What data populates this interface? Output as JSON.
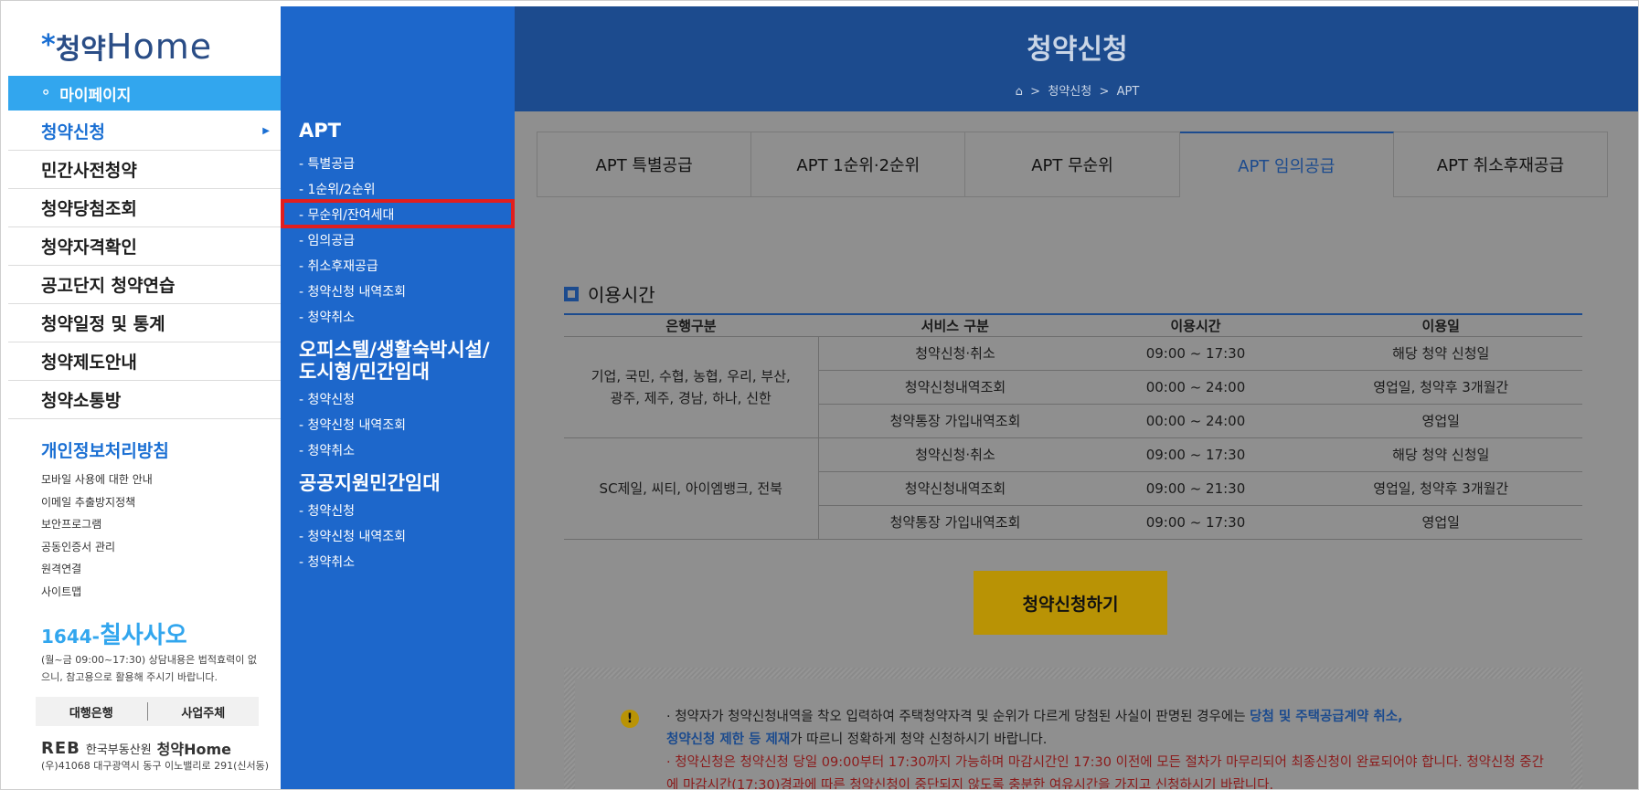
{
  "logo": {
    "star": "*",
    "kr": "청약",
    "en": "Home"
  },
  "mypage": {
    "icon": "person-icon",
    "label": "마이페이지"
  },
  "menu": [
    {
      "label": "청약신청",
      "active": true
    },
    {
      "label": "민간사전청약"
    },
    {
      "label": "청약당첨조회"
    },
    {
      "label": "청약자격확인"
    },
    {
      "label": "공고단지 청약연습"
    },
    {
      "label": "청약일정 및 통계"
    },
    {
      "label": "청약제도안내"
    },
    {
      "label": "청약소통방"
    }
  ],
  "privacy": "개인정보처리방침",
  "links": [
    "모바일 사용에 대한 안내",
    "이메일 추출방지정책",
    "보안프로그램",
    "공동인증서 관리",
    "원격연결",
    "사이트맵"
  ],
  "phone": {
    "prefix": "1644-",
    "name": "칠사사오"
  },
  "hours_notice": "(월~금 09:00~17:30) 상담내용은 법적효력이 없으니, 참고용으로 활용해 주시기 바랍니다.",
  "footer_tabs": [
    "대행은행",
    "사업주체"
  ],
  "reb": {
    "logo": "REB",
    "org": "한국부동산원",
    "home": "청약Home"
  },
  "address": "(우)41068 대구광역시 동구 이노밸리로 291(신서동)",
  "submenu": {
    "apt": {
      "title": "APT",
      "items": [
        "- 특별공급",
        "- 1순위/2순위",
        "- 무순위/잔여세대",
        "- 임의공급",
        "- 취소후재공급",
        "- 청약신청 내역조회",
        "- 청약취소"
      ]
    },
    "officetel": {
      "title_line1": "오피스텔/생활숙박시설/",
      "title_line2": "도시형/민간임대",
      "items": [
        "- 청약신청",
        "- 청약신청 내역조회",
        "- 청약취소"
      ]
    },
    "public": {
      "title": "공공지원민간임대",
      "items": [
        "- 청약신청",
        "- 청약신청 내역조회",
        "- 청약취소"
      ]
    }
  },
  "banner": {
    "title": "청약신청",
    "home_icon": "home-icon",
    "crumb1": "청약신청",
    "crumb2": "APT"
  },
  "tabs": [
    {
      "label": "APT 특별공급"
    },
    {
      "label": "APT 1순위·2순위"
    },
    {
      "label": "APT 무순위"
    },
    {
      "label": "APT 임의공급",
      "active": true
    },
    {
      "label": "APT 취소후재공급"
    }
  ],
  "section_title": "이용시간",
  "table": {
    "headers": [
      "은행구분",
      "서비스 구분",
      "이용시간",
      "이용일"
    ],
    "groups": [
      {
        "bank": [
          "기업, 국민, 수협, 농협, 우리, 부산,",
          "광주, 제주, 경남, 하나, 신한"
        ],
        "rows": [
          [
            "청약신청·취소",
            "09:00 ~ 17:30",
            "해당 청약 신청일"
          ],
          [
            "청약신청내역조회",
            "00:00 ~ 24:00",
            "영업일, 청약후 3개월간"
          ],
          [
            "청약통장 가입내역조회",
            "00:00 ~ 24:00",
            "영업일"
          ]
        ]
      },
      {
        "bank": [
          "SC제일, 씨티, 아이엠뱅크, 전북"
        ],
        "rows": [
          [
            "청약신청·취소",
            "09:00 ~ 17:30",
            "해당 청약 신청일"
          ],
          [
            "청약신청내역조회",
            "09:00 ~ 21:30",
            "영업일, 청약후 3개월간"
          ],
          [
            "청약통장 가입내역조회",
            "09:00 ~ 17:30",
            "영업일"
          ]
        ]
      }
    ]
  },
  "apply_button": "청약신청하기",
  "notice": {
    "warn_icon": "!",
    "p1_a": "· 청약자가 청약신청내역을 착오 입력하여 주택청약자격 및 순위가 다르게 당첨된 사실이 판명된 경우에는 ",
    "p1_b": "당첨 및 주택공급계약 취소,",
    "p1_c": "청약신청 제한 등 제재",
    "p1_d": "가 따르니 정확하게 청약 신청하시기 바랍니다.",
    "p2": "· 청약신청은 청약신청 당일 09:00부터 17:30까지 가능하며 마감시간인 17:30 이전에 모든 절차가 마무리되어 최종신청이 완료되어야 합니다. 청약신청 중간에 마감시간(17:30)경과에 따른 청약신청이 중단되지 않도록 충분한 여유시간을 가지고 신청하시기 바랍니다."
  }
}
